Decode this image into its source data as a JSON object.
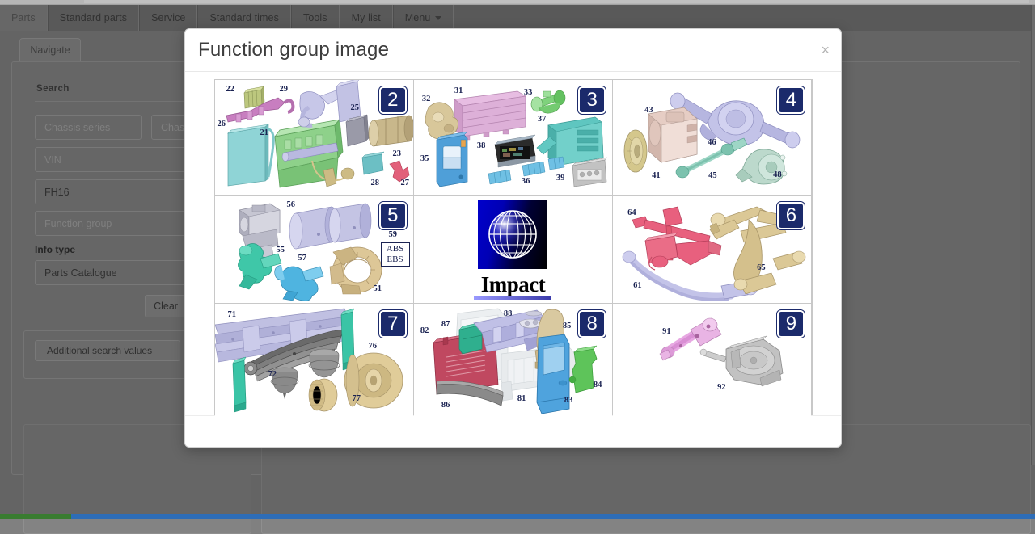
{
  "nav": {
    "tabs": [
      {
        "label": "Parts",
        "active": true
      },
      {
        "label": "Standard parts",
        "active": false
      },
      {
        "label": "Service",
        "active": false
      },
      {
        "label": "Standard times",
        "active": false
      },
      {
        "label": "Tools",
        "active": false
      },
      {
        "label": "My list",
        "active": false
      },
      {
        "label": "Menu",
        "active": false,
        "has_caret": true
      }
    ]
  },
  "subnav": {
    "tab_label": "Navigate"
  },
  "search": {
    "section_label": "Search",
    "chassis_series_placeholder": "Chassis series",
    "chassis_no_placeholder": "Chassis No",
    "vin_placeholder": "VIN",
    "model_value": "FH16",
    "function_group_placeholder": "Function group",
    "info_type_label": "Info type",
    "info_type_value": "Parts Catalogue",
    "clear_label": "Clear",
    "additional_label": "Additional search values",
    "green_button_color": "#1f7a21"
  },
  "modal": {
    "title": "Function group image",
    "close_label": "×",
    "badge_color": "#1b2a6b",
    "cells": [
      {
        "badge": "2",
        "position": "row1-col1",
        "part_numbers": [
          "22",
          "29",
          "25",
          "26",
          "21",
          "23",
          "28",
          "27"
        ]
      },
      {
        "badge": "3",
        "position": "row1-col2",
        "part_numbers": [
          "32",
          "31",
          "33",
          "37",
          "35",
          "38",
          "36",
          "39"
        ]
      },
      {
        "badge": "4",
        "position": "row1-col3",
        "part_numbers": [
          "43",
          "46",
          "41",
          "45",
          "48"
        ]
      },
      {
        "badge": "5",
        "position": "row2-col1",
        "part_numbers": [
          "56",
          "55",
          "57",
          "51",
          "59"
        ],
        "extra_label": "ABS\nEBS",
        "extra_label_lines": [
          "ABS",
          "EBS"
        ]
      },
      {
        "badge": "",
        "position": "row2-col2",
        "logo_text": "Impact",
        "part_numbers": []
      },
      {
        "badge": "6",
        "position": "row2-col3",
        "part_numbers": [
          "64",
          "61",
          "65"
        ]
      },
      {
        "badge": "7",
        "position": "row3-col1",
        "part_numbers": [
          "71",
          "72",
          "76",
          "77"
        ]
      },
      {
        "badge": "8",
        "position": "row3-col2",
        "part_numbers": [
          "88",
          "87",
          "82",
          "85",
          "81",
          "83",
          "84",
          "86"
        ]
      },
      {
        "badge": "9",
        "position": "row3-col3",
        "part_numbers": [
          "91",
          "92"
        ]
      }
    ]
  }
}
